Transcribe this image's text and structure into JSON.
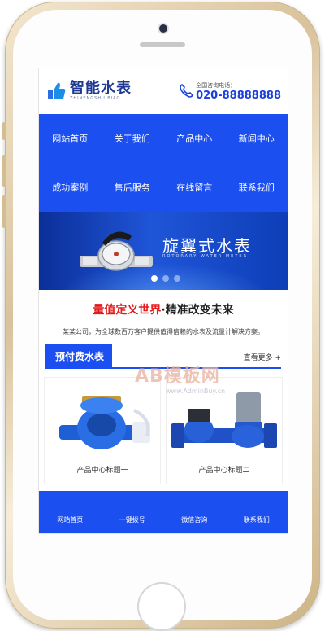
{
  "header": {
    "logo_name": "智能水表",
    "logo_pinyin": "ZHINENGSHUIBIAO",
    "contact_label": "全国咨询电话：",
    "contact_phone": "020-88888888"
  },
  "nav": [
    {
      "label": "网站首页"
    },
    {
      "label": "关于我们"
    },
    {
      "label": "产品中心"
    },
    {
      "label": "新闻中心"
    },
    {
      "label": "成功案例"
    },
    {
      "label": "售后服务"
    },
    {
      "label": "在线留言"
    },
    {
      "label": "联系我们"
    }
  ],
  "banner": {
    "title": "旋翼式水表",
    "subtitle": "ROTORARY WATER METER",
    "slide_count": 3,
    "active_slide": 1
  },
  "slogan": {
    "red_part": "量值定义世界",
    "dark_part": "·精准改变未来"
  },
  "intro": "某某公司，为全球数百万客户提供值得信赖的水表及流量计解决方案。",
  "section": {
    "title": "预付费水表",
    "more": "查看更多 +"
  },
  "products": [
    {
      "caption": "产品中心标题一"
    },
    {
      "caption": "产品中心标题二"
    }
  ],
  "footer": [
    {
      "label": "网站首页"
    },
    {
      "label": "一键拨号"
    },
    {
      "label": "微信咨询"
    },
    {
      "label": "联系我们"
    }
  ],
  "watermark": {
    "text": "AB模板网",
    "url": "www.AdminBuy.cn"
  },
  "colors": {
    "primary": "#1c4ff0",
    "accent_red": "#e21b1b",
    "phone_frame": "#d9c29b"
  }
}
